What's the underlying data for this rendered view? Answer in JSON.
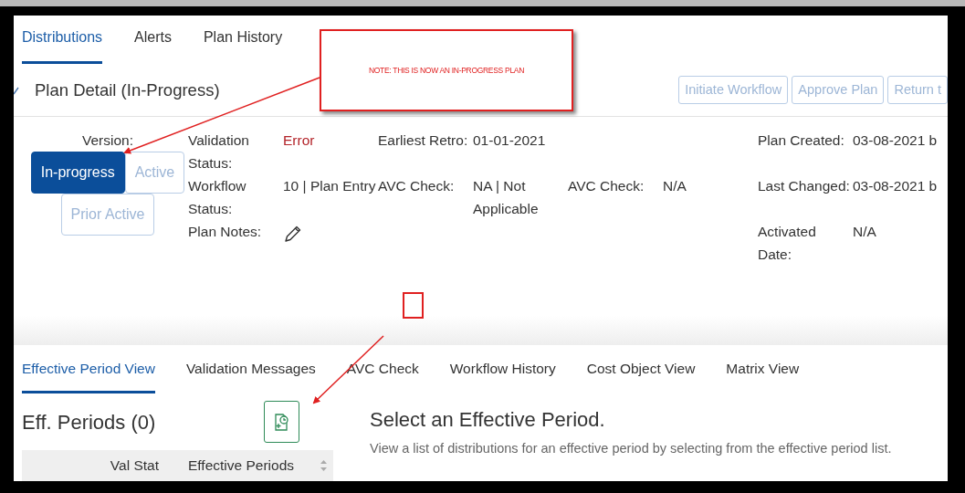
{
  "top_tabs": [
    {
      "label": "Distributions",
      "selected": true
    },
    {
      "label": "Alerts",
      "selected": false
    },
    {
      "label": "Plan History",
      "selected": false
    }
  ],
  "plan": {
    "title": "Plan Detail (In-Progress)"
  },
  "actions": [
    {
      "label": "Initiate Workflow",
      "disabled": true
    },
    {
      "label": "Approve Plan",
      "disabled": true
    },
    {
      "label": "Return t",
      "disabled": true
    }
  ],
  "version": {
    "label": "Version:",
    "options": [
      {
        "label": "In-progress",
        "selected": true
      },
      {
        "label": "Active",
        "selected": false
      },
      {
        "label": "Prior Active",
        "selected": false
      }
    ]
  },
  "details": [
    {
      "column_1": {
        "label": "Validation Status:",
        "value": "Error",
        "kind": "error"
      },
      "column_2": {
        "label": "Earliest Retro:",
        "value": "01-01-2021",
        "kind": "text"
      },
      "column_4": {
        "label": "Plan Created:",
        "value": "03-08-2021 b",
        "kind": "text"
      }
    },
    {
      "column_1": {
        "label": "Workflow Status:",
        "value": "10 | Plan Entry",
        "kind": "text"
      },
      "column_2": {
        "label": "AVC Check:",
        "value": "NA | Not Applicable",
        "kind": "text"
      },
      "column_3": {
        "label": "AVC Check:",
        "value": "N/A",
        "kind": "text"
      },
      "column_4": {
        "label": "Last Changed:",
        "value": "03-08-2021 b",
        "kind": "text"
      }
    },
    {
      "column_1": {
        "label": "Plan Notes:",
        "kind": "edit"
      },
      "column_4": {
        "label": "Activated Date:",
        "value": "N/A",
        "kind": "text"
      }
    }
  ],
  "annotation": {
    "note": "NOTE: THIS IS NOW AN IN-PROGRESS PLAN"
  },
  "sub_tabs": [
    {
      "label": "Effective Period View",
      "selected": true
    },
    {
      "label": "Validation Messages",
      "selected": false
    },
    {
      "label": "AVC Check",
      "selected": false
    },
    {
      "label": "Workflow History",
      "selected": false
    },
    {
      "label": "Cost Object View",
      "selected": false
    },
    {
      "label": "Matrix View",
      "selected": false
    }
  ],
  "eff_periods": {
    "title": "Eff. Periods (0)",
    "columns": [
      "Val Stat",
      "Effective Periods"
    ]
  },
  "detail_panel": {
    "heading": "Select an Effective Period.",
    "text": "View a list of distributions for an effective period by selecting from the effective period list."
  }
}
